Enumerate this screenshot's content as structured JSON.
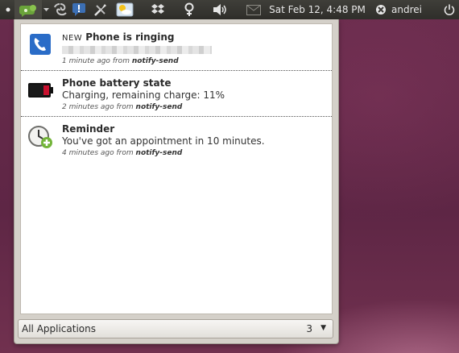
{
  "panel": {
    "clock": "Sat Feb 12,  4:48 PM",
    "username": "andrei",
    "indicators": [
      "bullet-dot-icon",
      "messaging-indicator-icon",
      "update-spiral-icon",
      "notification-bubble-icon",
      "tools-icon",
      "weather-icon",
      "dropbox-icon",
      "gender-symbol-icon",
      "volume-icon",
      "mail-icon"
    ]
  },
  "popup": {
    "messages": [
      {
        "icon": "phone-icon",
        "new_tag": "NEW",
        "title": "Phone is ringing",
        "body": "",
        "time": "1 minute ago",
        "from_prefix": "from",
        "source": "notify-send"
      },
      {
        "icon": "battery-icon",
        "new_tag": "",
        "title": "Phone battery state",
        "body": "Charging, remaining charge: 11%",
        "time": "2 minutes ago",
        "from_prefix": "from",
        "source": "notify-send"
      },
      {
        "icon": "clock-icon",
        "new_tag": "",
        "title": "Reminder",
        "body": "You've got an appointment in 10 minutes.",
        "time": "4 minutes ago",
        "from_prefix": "from",
        "source": "notify-send"
      }
    ],
    "filter": {
      "label": "All Applications",
      "count": "3",
      "arrow": "▼"
    }
  },
  "colors": {
    "panel": "#3a3935",
    "accent_green": "#6aa33a",
    "battery_red": "#c8102e",
    "desktop": "#5e2645"
  }
}
